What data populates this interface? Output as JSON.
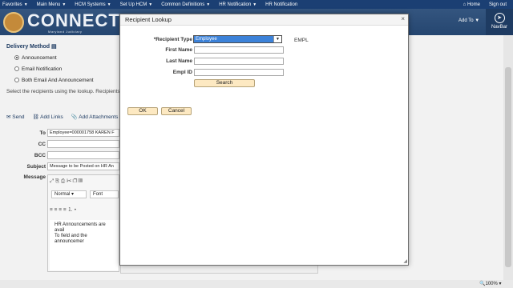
{
  "topnav": {
    "favorites": "Favorites",
    "main_menu": "Main Menu",
    "hcm_systems": "HCM Systems",
    "setup_hcm": "Set Up HCM",
    "common_definitions": "Common Definitions",
    "hr_notification": "HR Notification",
    "hr_notification_page": "HR Notification",
    "home": "Home",
    "sign_out": "Sign out"
  },
  "header": {
    "logo": "CONNECT",
    "logo_sub": "Maryland Judiciary",
    "add_to": "Add To",
    "navbar": "NavBar"
  },
  "page": {
    "section_title": "Delivery Method",
    "radio_announcement": "Announcement",
    "radio_email": "Email Notification",
    "radio_both": "Both Email And Announcement",
    "instructions": "Select the recipients using the lookup. Recipients sh",
    "send": "Send",
    "add_links": "Add Links",
    "add_attachments": "Add Attachments",
    "to_label": "To",
    "to_value": "Employee=000001758 KAREN F",
    "cc_label": "CC",
    "bcc_label": "BCC",
    "subject_label": "Subject",
    "subject_value": "Message to be Posted on HR An",
    "message_label": "Message",
    "format_value": "Normal",
    "font_value": "Font",
    "body_line1": "HR Announcements are avail",
    "body_line2": "To field and the announcemer"
  },
  "modal": {
    "title": "Recipient Lookup",
    "recipient_type_label": "*Recipient Type",
    "recipient_type_value": "Employee",
    "recipient_type_code": "EMPL",
    "first_name_label": "First Name",
    "last_name_label": "Last Name",
    "empl_id_label": "Empl ID",
    "search_button": "Search",
    "ok_button": "OK",
    "cancel_button": "Cancel"
  },
  "status": {
    "zoom": "100%"
  }
}
